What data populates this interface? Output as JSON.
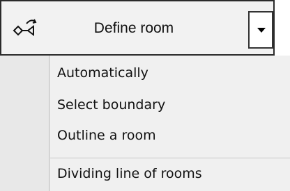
{
  "toolbar": {
    "icon": "define-room-icon",
    "label": "Define room",
    "dropdown_icon": "chevron-down-icon"
  },
  "menu": {
    "items": [
      {
        "label": "Automatically"
      },
      {
        "label": "Select boundary"
      },
      {
        "label": "Outline a room"
      },
      {
        "label": "Dividing line of rooms"
      }
    ]
  }
}
